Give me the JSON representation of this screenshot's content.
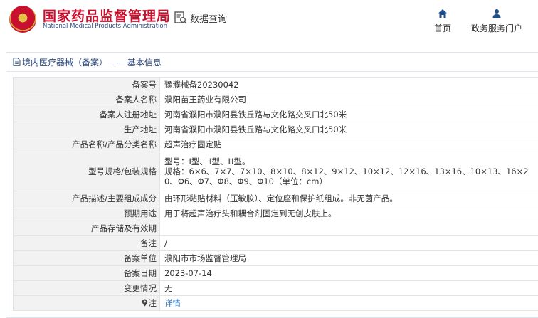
{
  "header": {
    "logo_cn": "国家药品监督管理局",
    "logo_en": "National Medical Products Administration",
    "search_label": "数据查询",
    "nav": [
      {
        "label": "首页",
        "icon": "home-icon"
      },
      {
        "label": "政务服务门户",
        "icon": "user-icon"
      }
    ]
  },
  "panel": {
    "title": "境内医疗器械（备案） ——基本信息"
  },
  "rows": [
    {
      "label": "备案号",
      "value": "豫濮械备20230042"
    },
    {
      "label": "备案人名称",
      "value": "濮阳苗王药业有限公司"
    },
    {
      "label": "备案人注册地址",
      "value": "河南省濮阳市濮阳县铁丘路与文化路交叉口北50米"
    },
    {
      "label": "生产地址",
      "value": "河南省濮阳市濮阳县铁丘路与文化路交叉口北50米"
    },
    {
      "label": "产品名称/产品分类名称",
      "value": "超声治疗固定贴"
    },
    {
      "label": "型号规格/包装规格",
      "value": "型号：Ⅰ型、Ⅱ型、Ⅲ型。\n规格：6×6、7×7、7×10、8×10、8×12、9×12、10×12、12×16、13×16、10×13、16×20、Φ6、Φ7、Φ8、Φ9、Φ10（单位：cm）"
    },
    {
      "label": "产品描述/主要组成成分",
      "value": "由环形黏贴材料（压敏胶）、定位座和保护纸组成。非无菌产品。"
    },
    {
      "label": "预期用途",
      "value": "用于将超声治疗头和耦合剂固定到无创皮肤上。"
    },
    {
      "label": "产品存储及有效期",
      "value": ""
    },
    {
      "label": "备注",
      "value": "/"
    },
    {
      "label": "备案单位",
      "value": "濮阳市市场监督管理局"
    },
    {
      "label": "备案日期",
      "value": "2023-07-14"
    },
    {
      "label": "变更情况",
      "value": "无"
    },
    {
      "label": "注",
      "value": "详情"
    }
  ],
  "colors": {
    "brand_red": "#c8102e",
    "title_blue": "#2c4a7e",
    "link_blue": "#2c6fb8",
    "label_bg": "#f2f2f2"
  }
}
